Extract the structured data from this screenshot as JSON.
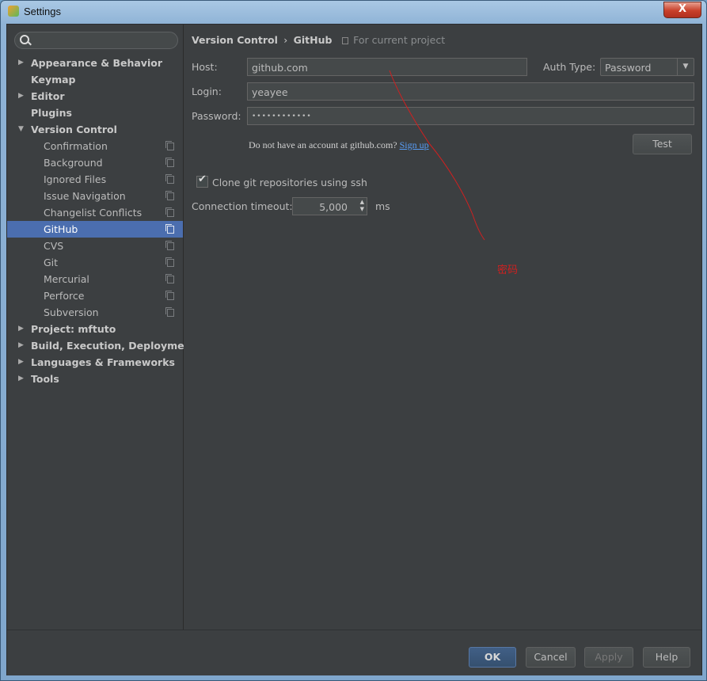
{
  "window": {
    "title": "Settings",
    "close": "X"
  },
  "sidebar": {
    "items": [
      {
        "label": "Appearance & Behavior",
        "level": 0,
        "arrow": "▶"
      },
      {
        "label": "Keymap",
        "level": 0,
        "arrow": ""
      },
      {
        "label": "Editor",
        "level": 0,
        "arrow": "▶"
      },
      {
        "label": "Plugins",
        "level": 0,
        "arrow": ""
      },
      {
        "label": "Version Control",
        "level": 0,
        "arrow": "▼"
      },
      {
        "label": "Confirmation",
        "level": 1
      },
      {
        "label": "Background",
        "level": 1
      },
      {
        "label": "Ignored Files",
        "level": 1
      },
      {
        "label": "Issue Navigation",
        "level": 1
      },
      {
        "label": "Changelist Conflicts",
        "level": 1
      },
      {
        "label": "GitHub",
        "level": 1,
        "selected": true
      },
      {
        "label": "CVS",
        "level": 1
      },
      {
        "label": "Git",
        "level": 1
      },
      {
        "label": "Mercurial",
        "level": 1
      },
      {
        "label": "Perforce",
        "level": 1
      },
      {
        "label": "Subversion",
        "level": 1
      },
      {
        "label": "Project: mftuto",
        "level": 0,
        "arrow": "▶"
      },
      {
        "label": "Build, Execution, Deployment",
        "level": 0,
        "arrow": "▶"
      },
      {
        "label": "Languages & Frameworks",
        "level": 0,
        "arrow": "▶"
      },
      {
        "label": "Tools",
        "level": 0,
        "arrow": "▶"
      }
    ]
  },
  "breadcrumb": {
    "parent": "Version Control",
    "sep": "›",
    "current": "GitHub",
    "scope": "For current project"
  },
  "form": {
    "host_label": "Host:",
    "host_value": "github.com",
    "auth_label": "Auth Type:",
    "auth_value": "Password",
    "login_label": "Login:",
    "login_value": "yeayee",
    "password_label": "Password:",
    "password_value": "••••••••••••",
    "signup_text": "Do not have an account at github.com?",
    "signup_link": "Sign up",
    "test_button": "Test",
    "clone_label": "Clone git repositories using ssh",
    "clone_checked": true,
    "timeout_label": "Connection timeout:",
    "timeout_value": "5,000",
    "timeout_unit": "ms"
  },
  "annotation": {
    "text": "密码",
    "color": "#d02020"
  },
  "footer": {
    "ok": "OK",
    "cancel": "Cancel",
    "apply": "Apply",
    "help": "Help"
  },
  "colors": {
    "selection": "#4b6eaf",
    "background": "#3c3f41",
    "link": "#589df6"
  }
}
